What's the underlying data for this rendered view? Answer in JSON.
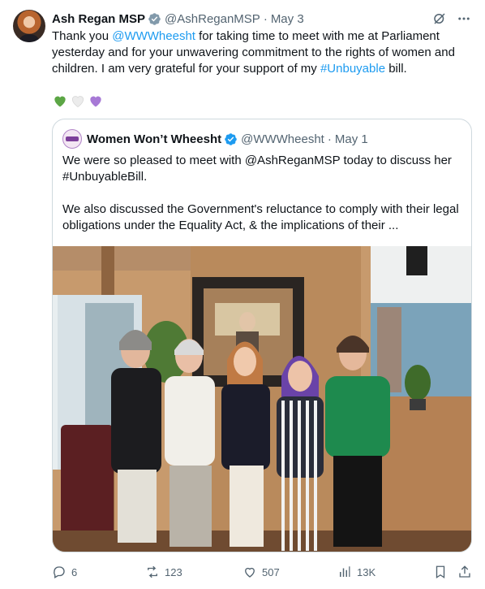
{
  "author": {
    "name": "Ash Regan MSP",
    "handle": "@AshReganMSP",
    "separator": "·",
    "date": "May 3"
  },
  "tweet": {
    "text_1": "Thank you ",
    "mention": "@WWWheesht",
    "text_2": " for taking time to meet with me at Parliament yesterday and for your unwavering commitment to the rights of women and children. I am very grateful for your support of my ",
    "hashtag": "#Unbuyable",
    "text_3": " bill.",
    "emojis": [
      "green-heart",
      "white-heart",
      "purple-heart"
    ]
  },
  "quote": {
    "name": "Women Won’t Wheesht",
    "handle": "@WWWheesht",
    "separator": "·",
    "date": "May 1",
    "paragraph_1": "We were so pleased to meet with @AshReganMSP today to discuss her #UnbuyableBill.",
    "paragraph_2": "We also discussed the Government's reluctance to comply with their legal obligations under the Equality Act, & the implications of their ..."
  },
  "actions": {
    "replies": "6",
    "reposts": "123",
    "likes": "507",
    "views": "13K"
  },
  "colors": {
    "link": "#1d9bf0",
    "muted": "#536471",
    "verified": "#1d9bf0",
    "border": "#cfd9de"
  }
}
